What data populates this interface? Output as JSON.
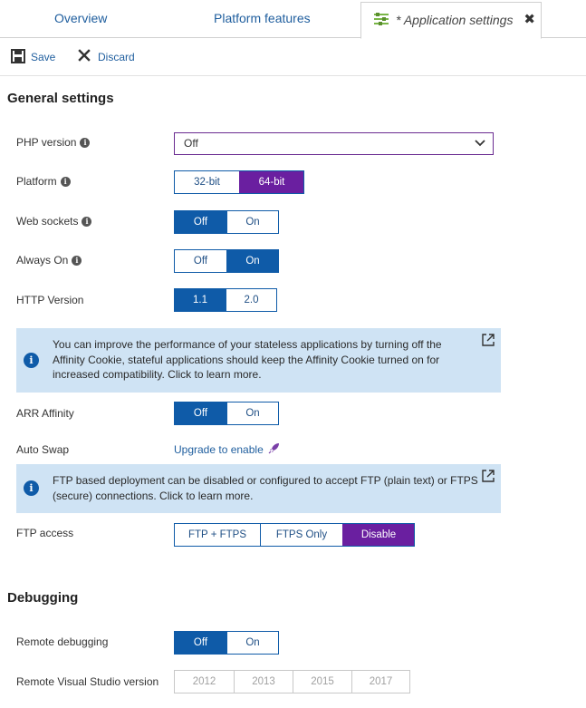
{
  "tabs": [
    {
      "label": "Overview"
    },
    {
      "label": "Platform features"
    },
    {
      "label": "* Application settings"
    }
  ],
  "toolbar": {
    "save_label": "Save",
    "discard_label": "Discard"
  },
  "general": {
    "title": "General settings",
    "php": {
      "label": "PHP version",
      "value": "Off"
    },
    "platform": {
      "label": "Platform",
      "options": [
        "32-bit",
        "64-bit"
      ],
      "selected": "64-bit"
    },
    "web_sockets": {
      "label": "Web sockets",
      "options": [
        "Off",
        "On"
      ],
      "selected": "Off"
    },
    "always_on": {
      "label": "Always On",
      "options": [
        "Off",
        "On"
      ],
      "selected": "On"
    },
    "http_version": {
      "label": "HTTP Version",
      "options": [
        "1.1",
        "2.0"
      ],
      "selected": "1.1"
    },
    "affinity_info": {
      "line1": "You can improve the performance of your stateless applications by turning off the",
      "line2": "Affinity Cookie, stateful applications should keep the Affinity Cookie turned on for",
      "line3": "increased compatibility. Click to learn more."
    },
    "arr_affinity": {
      "label": "ARR Affinity",
      "options": [
        "Off",
        "On"
      ],
      "selected": "Off"
    },
    "auto_swap": {
      "label": "Auto Swap",
      "link": "Upgrade to enable"
    },
    "ftp_info": {
      "line1": "FTP based deployment can be disabled or configured to accept FTP (plain text) or FTPS",
      "line2": "(secure) connections. Click to learn more."
    },
    "ftp_access": {
      "label": "FTP access",
      "options": [
        "FTP + FTPS",
        "FTPS Only",
        "Disable"
      ],
      "selected": "Disable"
    }
  },
  "debugging": {
    "title": "Debugging",
    "remote_debugging": {
      "label": "Remote debugging",
      "options": [
        "Off",
        "On"
      ],
      "selected": "Off"
    },
    "vs_version": {
      "label": "Remote Visual Studio version",
      "options": [
        "2012",
        "2013",
        "2015",
        "2017"
      ]
    }
  },
  "colors": {
    "accent_blue": "#0f5ba8",
    "accent_purple": "#6a1fa0",
    "info_bg": "#cfe3f4",
    "link": "#1f5e9e"
  }
}
